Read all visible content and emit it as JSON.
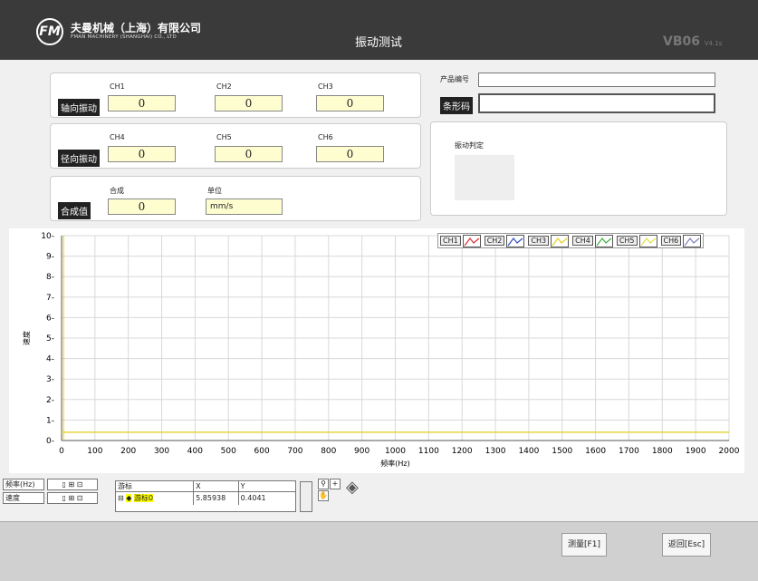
{
  "header": {
    "logo": "FM",
    "company_cn": "夫曼机械（上海）有限公司",
    "company_en": "FMAN MACHINERY (SHANGHAI) CO., LTD",
    "title": "振动测试",
    "version": "VB06",
    "version_sub": "V4.1s"
  },
  "axial": {
    "label": "轴向振动",
    "channels": [
      {
        "name": "CH1",
        "value": "0"
      },
      {
        "name": "CH2",
        "value": "0"
      },
      {
        "name": "CH3",
        "value": "0"
      }
    ]
  },
  "radial": {
    "label": "径向振动",
    "channels": [
      {
        "name": "CH4",
        "value": "0"
      },
      {
        "name": "CH5",
        "value": "0"
      },
      {
        "name": "CH6",
        "value": "0"
      }
    ]
  },
  "synth": {
    "label": "合成值",
    "combined_label": "合成",
    "combined_value": "0",
    "unit_label": "单位",
    "unit_value": "mm/s"
  },
  "product": {
    "number_label": "产品编号",
    "number_value": "",
    "barcode_label": "条形码",
    "barcode_value": ""
  },
  "judge": {
    "label": "振动判定"
  },
  "legend": [
    {
      "name": "CH1",
      "color": "#e03030"
    },
    {
      "name": "CH2",
      "color": "#3050c0"
    },
    {
      "name": "CH3",
      "color": "#e0d020"
    },
    {
      "name": "CH4",
      "color": "#40b040"
    },
    {
      "name": "CH5",
      "color": "#e0e040"
    },
    {
      "name": "CH6",
      "color": "#8080c0"
    }
  ],
  "chart_data": {
    "type": "line",
    "xlabel": "频率(Hz)",
    "ylabel": "速度",
    "xlim": [
      0,
      2000
    ],
    "ylim": [
      0,
      10
    ],
    "xticks": [
      0,
      100,
      200,
      300,
      400,
      500,
      600,
      700,
      800,
      900,
      1000,
      1100,
      1200,
      1300,
      1400,
      1500,
      1600,
      1700,
      1800,
      1900,
      2000
    ],
    "yticks": [
      0,
      1,
      2,
      3,
      4,
      5,
      6,
      7,
      8,
      9,
      10
    ],
    "grid": true,
    "series": [
      {
        "name": "CH1",
        "x": [
          0,
          2000
        ],
        "y": [
          0.4041,
          0.4041
        ]
      }
    ],
    "cursor": {
      "x": 5.85938,
      "y": 0.4041
    }
  },
  "controls": {
    "freq_label": "频率(Hz)",
    "speed_label": "速度",
    "cursor_header": [
      "游标",
      "X",
      "Y"
    ],
    "cursor_row": {
      "name": "游标0",
      "x": "5.85938",
      "y": "0.4041"
    }
  },
  "buttons": {
    "measure": "测量[F1]",
    "back": "返回[Esc]"
  }
}
